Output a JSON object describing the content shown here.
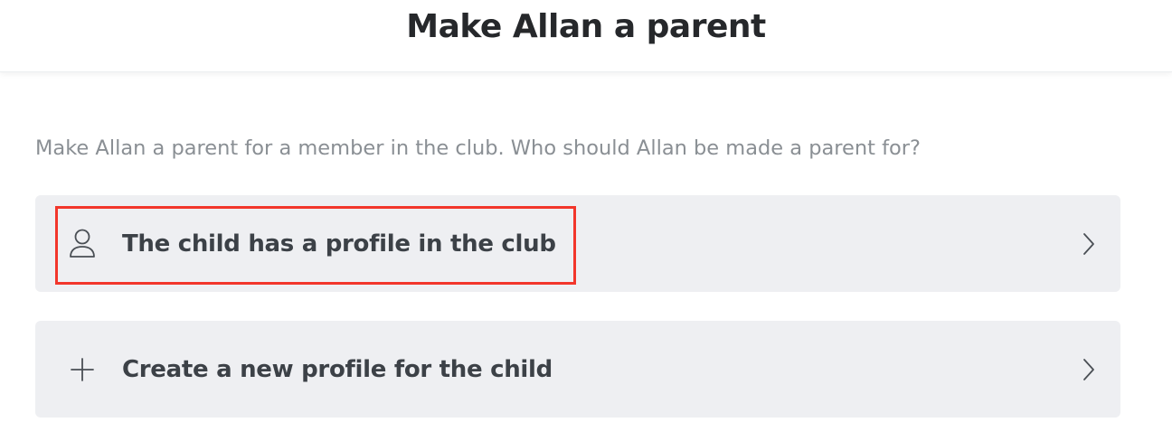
{
  "header": {
    "title": "Make Allan a parent"
  },
  "intro": {
    "text": "Make Allan a parent for a member in the club. Who should Allan be made a parent for?"
  },
  "options": [
    {
      "label": "The child has a profile in the club",
      "icon": "user-icon",
      "chevron": "chevron-right-icon",
      "highlighted": true
    },
    {
      "label": "Create a new profile for the child",
      "icon": "plus-icon",
      "chevron": "chevron-right-icon",
      "highlighted": false
    }
  ],
  "colors": {
    "option_background": "#eeeff2",
    "highlight_border": "#f2362b",
    "title_text": "#26282b",
    "intro_text": "#8a8f94",
    "option_text": "#3c4147"
  }
}
